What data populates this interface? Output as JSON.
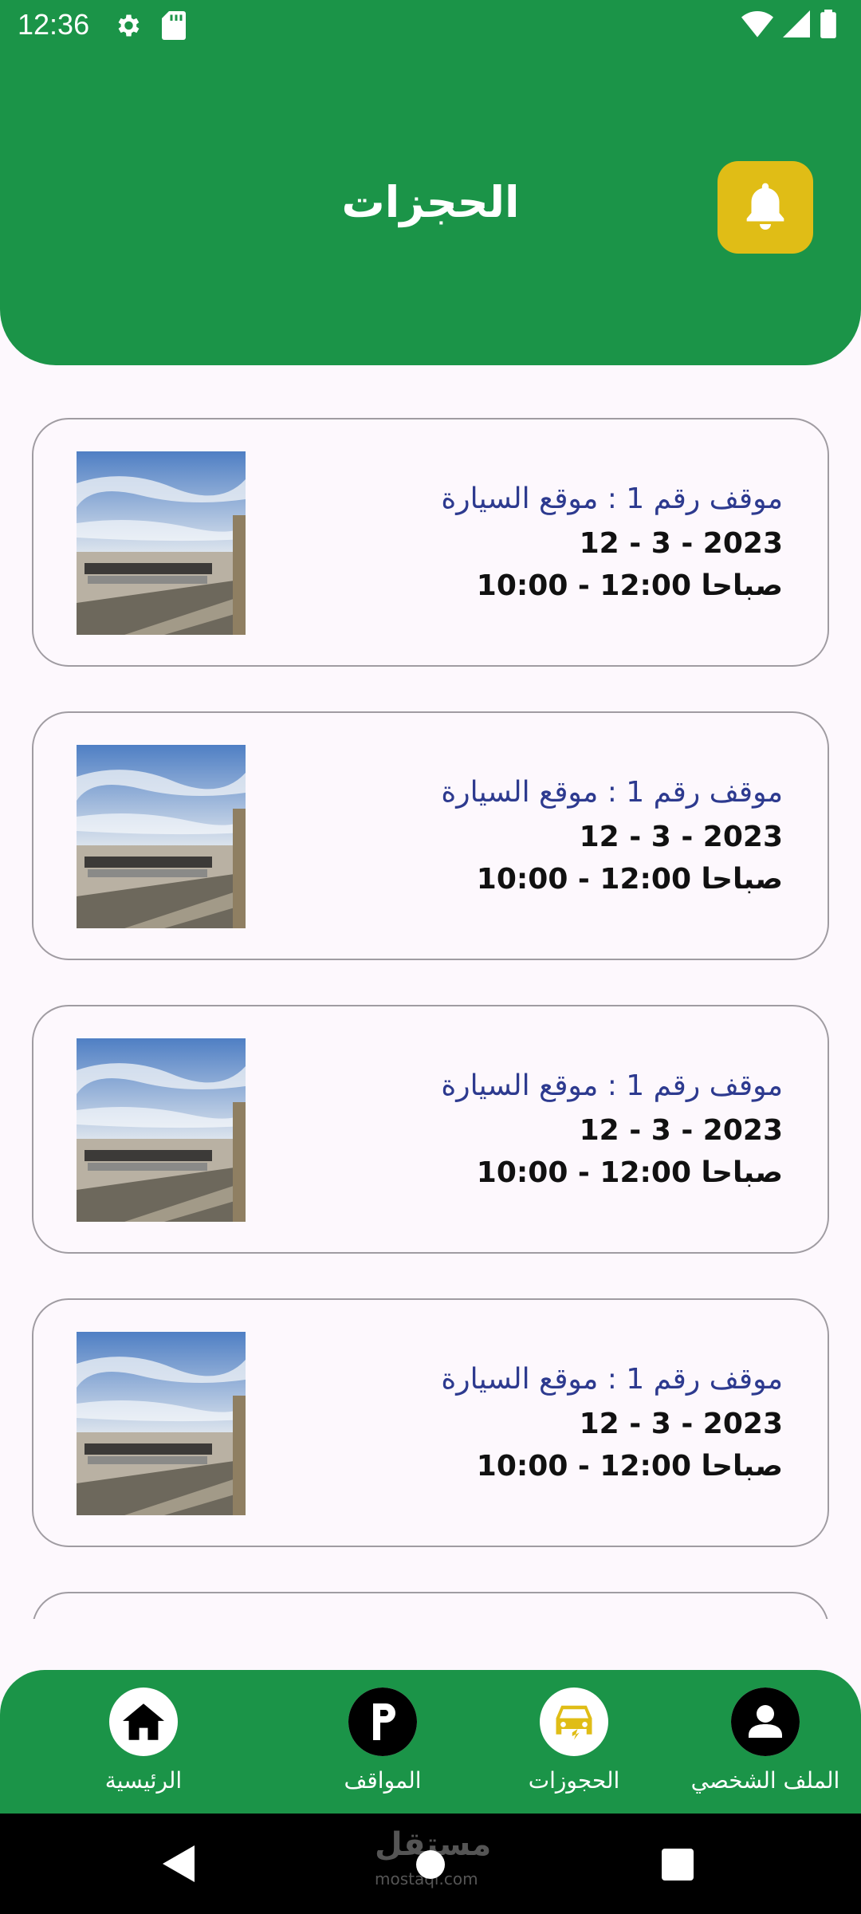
{
  "status_bar": {
    "time": "12:36"
  },
  "header": {
    "title": "الحجزات",
    "bell_icon": "bell-icon"
  },
  "bookings": [
    {
      "title": "موقف رقم 1 : موقع السيارة",
      "date": "2023 - 3 - 12",
      "time": "صباحا 12:00 - 10:00"
    },
    {
      "title": "موقف رقم 1 : موقع السيارة",
      "date": "2023 - 3 - 12",
      "time": "صباحا 12:00 - 10:00"
    },
    {
      "title": "موقف رقم 1 : موقع السيارة",
      "date": "2023 - 3 - 12",
      "time": "صباحا 12:00 - 10:00"
    },
    {
      "title": "موقف رقم 1 : موقع السيارة",
      "date": "2023 - 3 - 12",
      "time": "صباحا 12:00 - 10:00"
    }
  ],
  "bottom_nav": {
    "home": "الرئيسية",
    "parking": "المواقف",
    "bookings": "الحجوزات",
    "profile": "الملف الشخصي"
  },
  "watermark": {
    "main": "مستقل",
    "sub": "mostaql.com"
  },
  "colors": {
    "primary": "#1b9448",
    "accent": "#e0bd16",
    "title_text": "#2d3a8f"
  }
}
